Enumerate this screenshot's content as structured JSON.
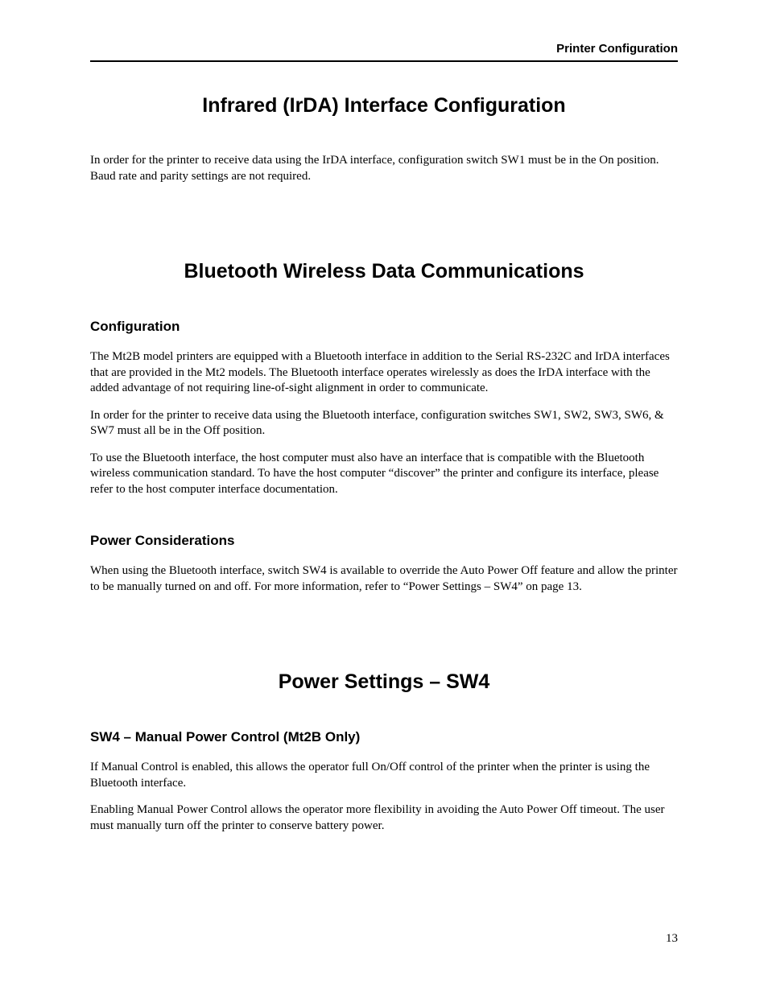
{
  "header": {
    "running_title": "Printer Configuration"
  },
  "section1": {
    "title": "Infrared (IrDA) Interface Configuration",
    "p1": "In order for the printer to receive data using the IrDA interface, configuration switch SW1 must be in the On position.  Baud rate and parity settings are not required."
  },
  "section2": {
    "title": "Bluetooth Wireless Data Communications",
    "sub1": {
      "heading": "Configuration",
      "p1": "The Mt2B model printers are equipped with a Bluetooth interface in addition to the Serial RS-232C and IrDA interfaces that are provided in the Mt2 models.  The Bluetooth interface operates wirelessly as does the IrDA interface with the added advantage of not requiring line-of-sight alignment in order to communicate.",
      "p2": "In order for the printer to receive data using the Bluetooth interface, configuration switches SW1, SW2, SW3, SW6, & SW7 must all be in the Off position.",
      "p3": "To use the Bluetooth interface, the host computer must also have an interface that is compatible with the Bluetooth wireless communication standard.  To have the host computer “discover” the printer and configure its interface, please refer to the host computer interface documentation."
    },
    "sub2": {
      "heading": "Power Considerations",
      "p1": "When using the Bluetooth interface, switch SW4 is available to override the Auto Power Off feature and allow the printer to be manually turned on and off.  For more information, refer to “Power Settings – SW4” on page 13."
    }
  },
  "section3": {
    "title": "Power Settings – SW4",
    "sub1": {
      "heading": "SW4 – Manual Power Control (Mt2B Only)",
      "p1": "If Manual Control is enabled, this allows the operator full On/Off control of the printer when the printer is using the Bluetooth interface.",
      "p2": "Enabling Manual Power Control allows the operator more flexibility in avoiding the Auto Power Off timeout.  The user must manually turn off the printer to conserve battery power."
    }
  },
  "footer": {
    "page_number": "13"
  }
}
